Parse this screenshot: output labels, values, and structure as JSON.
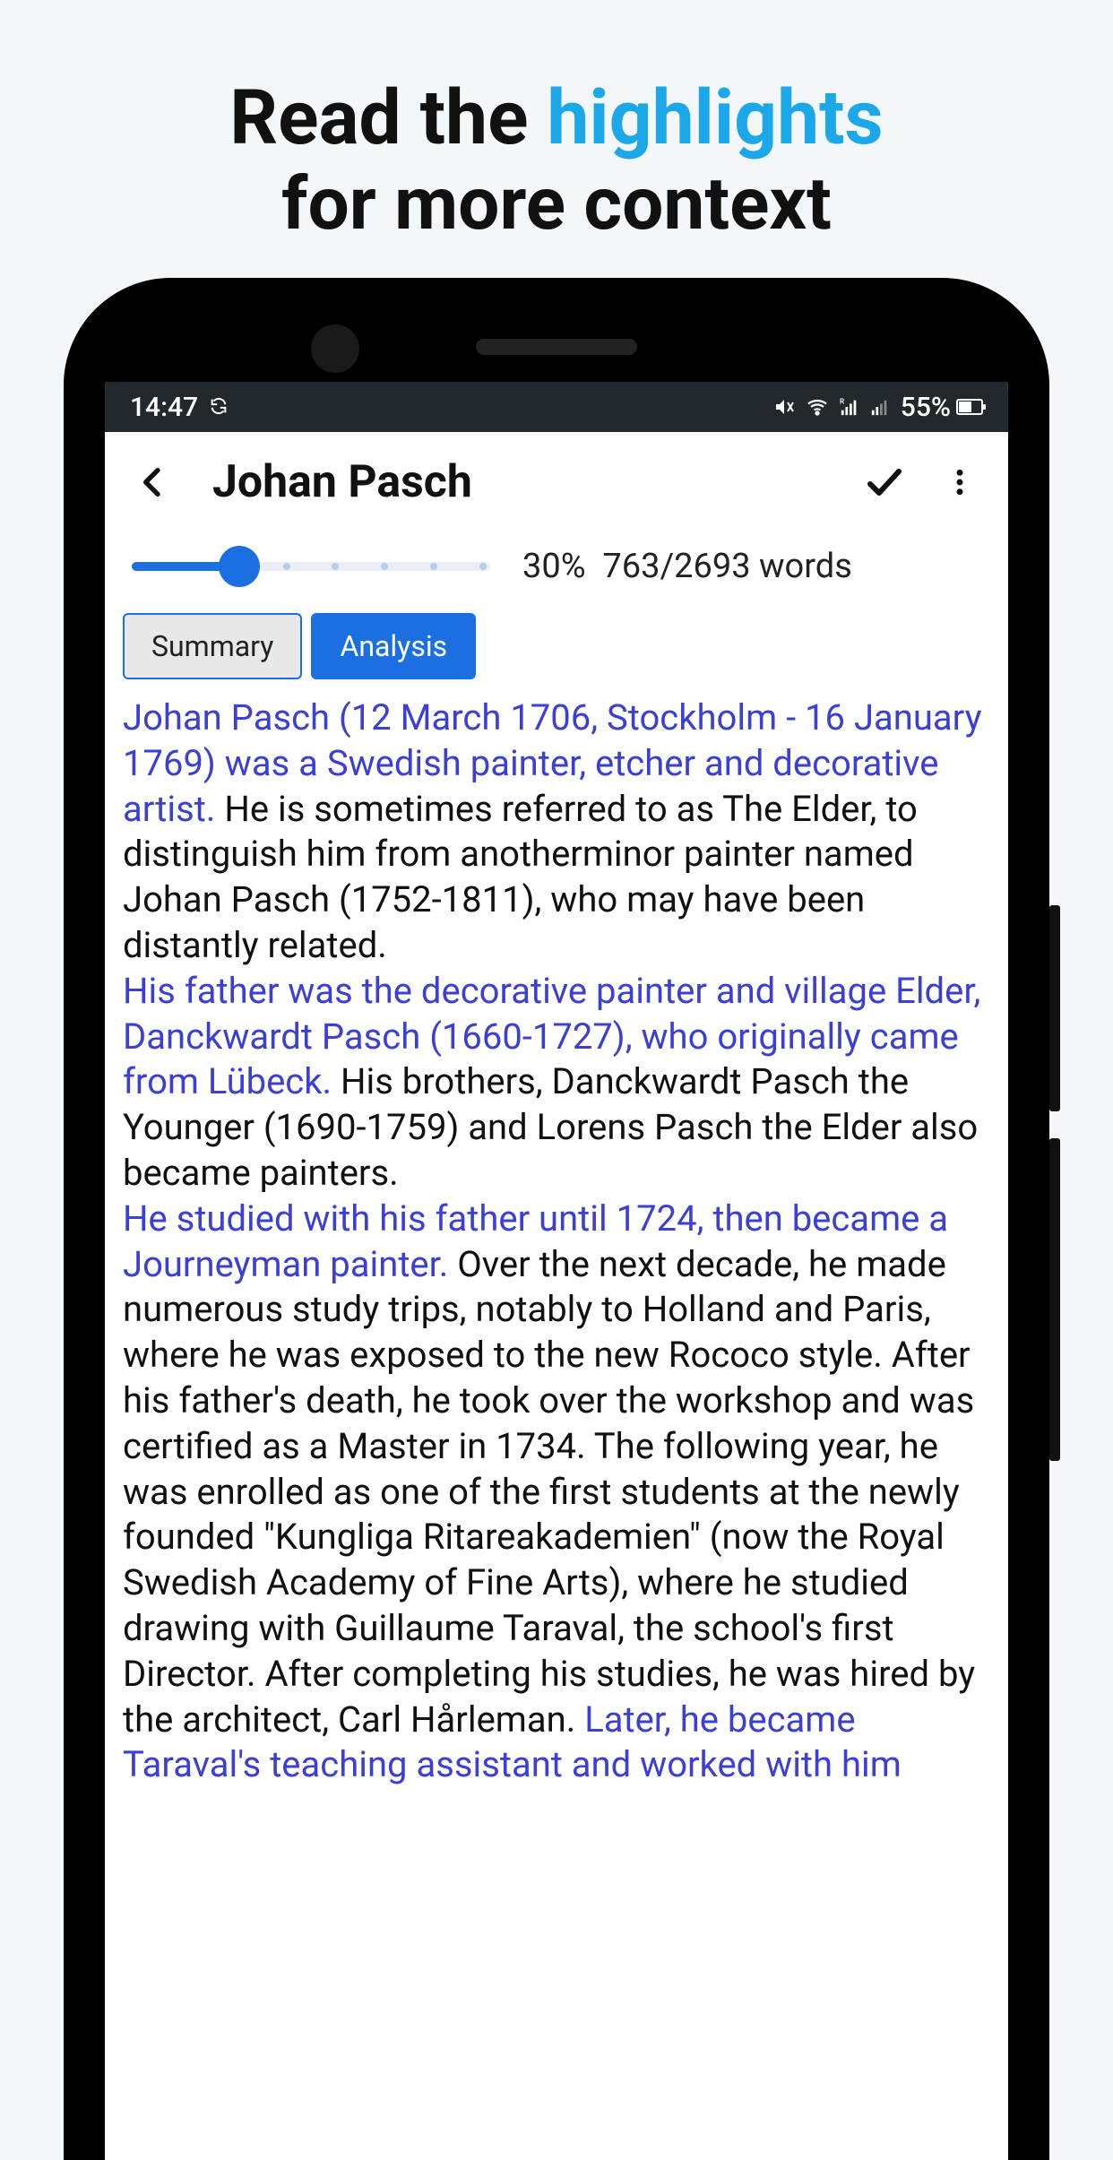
{
  "marketing": {
    "line1_a": "Read the ",
    "line1_b": "highlights",
    "line2": "for more context",
    "accent_color": "#1ba7e8"
  },
  "status": {
    "time": "14:47",
    "battery_pct": "55%"
  },
  "appbar": {
    "title": "Johan Pasch"
  },
  "slider": {
    "pct_value": 30,
    "pct_label": "30%",
    "words_label": "763/2693 words"
  },
  "tabs": {
    "summary": "Summary",
    "analysis": "Analysis",
    "selected": "Summary"
  },
  "article": {
    "p1_hl": "Johan Pasch (12 March 1706, Stockholm - 16 January 1769) was a Swedish painter, etcher and decorative artist.",
    "p1_plain": " He is sometimes referred to as The Elder, to distinguish him from anotherminor painter named Johan Pasch (1752-1811), who may have been distantly related.",
    "p2_hl": "His father was the decorative painter and village Elder, Danckwardt Pasch (1660-1727), who originally came from Lübeck.",
    "p2_plain": " His brothers, Danckwardt Pasch the Younger (1690-1759) and Lorens Pasch the Elder also became painters.",
    "p3_hl": "He studied with his father until 1724, then became a Journeyman painter.",
    "p3_plain": " Over the next decade, he made numerous study trips, notably to Holland and Paris, where he was exposed to the new Rococo style. After his father's death, he took over the workshop and was certified as a Master in 1734. The following year, he was enrolled as one of the first students at the newly founded \"Kungliga Ritareakademien\" (now the Royal Swedish Academy of Fine Arts), where he studied drawing with Guillaume Taraval, the school's first Director. After completing his studies, he was hired by the architect, Carl Hårleman. ",
    "p3_hl2": "Later, he became Taraval's teaching assistant and worked with him"
  }
}
